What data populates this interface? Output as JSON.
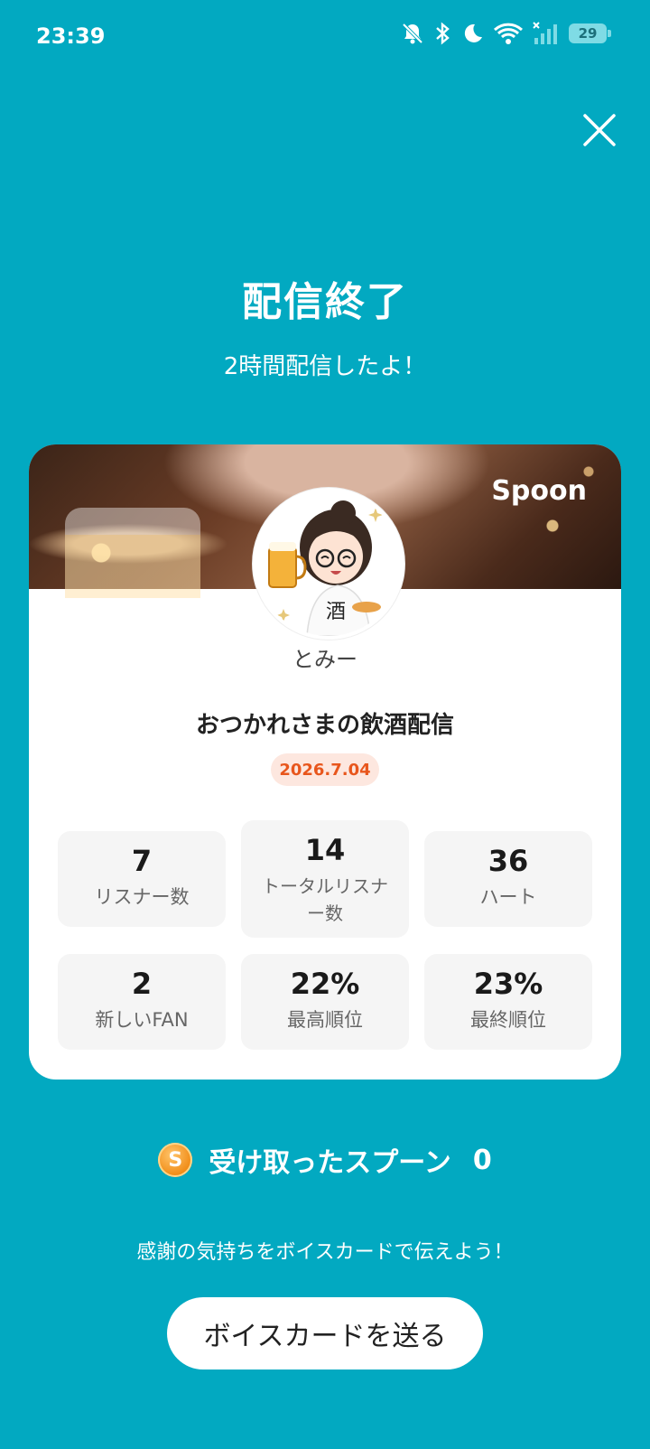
{
  "status_bar": {
    "time": "23:39",
    "battery": "29",
    "icons": [
      "bell-off-icon",
      "bluetooth-icon",
      "moon-icon",
      "wifi-icon",
      "signal-icon",
      "battery-icon"
    ]
  },
  "header": {
    "close_icon": "close-icon",
    "title": "配信終了",
    "subtitle": "2時間配信したよ！"
  },
  "card": {
    "brand": "Spoon",
    "username": "とみー",
    "stream_title": "おつかれさまの飲酒配信",
    "date": "2026.7.04",
    "stats": [
      {
        "value": "7",
        "label": "リスナー数"
      },
      {
        "value": "14",
        "label": "トータルリスナー数"
      },
      {
        "value": "36",
        "label": "ハート"
      },
      {
        "value": "2",
        "label": "新しいFAN"
      },
      {
        "value": "22%",
        "label": "最高順位"
      },
      {
        "value": "23%",
        "label": "最終順位"
      }
    ]
  },
  "spoons": {
    "coin_glyph": "S",
    "label": "受け取ったスプーン",
    "count": "0"
  },
  "footer": {
    "thanks_text": "感謝の気持ちをボイスカードで伝えよう！",
    "send_button": "ボイスカードを送る"
  },
  "colors": {
    "background": "#02a9c1",
    "date_badge_text": "#e8561c",
    "date_badge_bg": "#fde7df",
    "coin": "#f08a14"
  }
}
